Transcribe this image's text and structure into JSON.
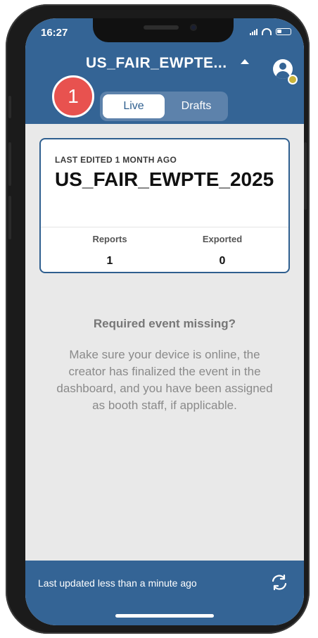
{
  "status_bar": {
    "time": "16:27"
  },
  "header": {
    "event_title": "US_FAIR_EWPTE...",
    "badge_number": "1",
    "tabs": [
      {
        "label": "Live",
        "active": true
      },
      {
        "label": "Drafts",
        "active": false
      }
    ],
    "icons": [
      "caret-up-icon",
      "account-icon"
    ]
  },
  "event_card": {
    "meta": "LAST EDITED 1 MONTH AGO",
    "name": "US_FAIR_EWPTE_2025",
    "stats": [
      {
        "label": "Reports",
        "value": "1"
      },
      {
        "label": "Exported",
        "value": "0"
      }
    ]
  },
  "empty_state": {
    "title": "Required event missing?",
    "body": "Make sure your device is online, the creator has finalized the event in the dashboard, and you have been assigned as booth staff, if applicable."
  },
  "footer": {
    "last_updated": "Last updated less than a minute ago",
    "icon": "refresh-icon"
  },
  "colors": {
    "primary": "#346495",
    "badge": "#e8524f",
    "background": "#e9e9e9"
  }
}
